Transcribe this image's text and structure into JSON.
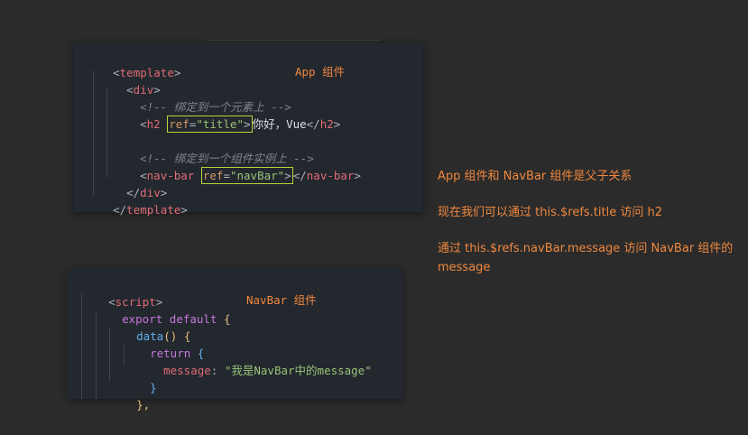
{
  "template_block": {
    "annotation": "App 组件",
    "line1": {
      "open": "<",
      "tag": "template",
      "close": ">"
    },
    "line2": {
      "open": "<",
      "tag": "div",
      "close": ">"
    },
    "line3": {
      "comment": "<!-- 绑定到一个元素上 -->"
    },
    "line4": {
      "open": "<",
      "tag": "h2",
      "space": " ",
      "attr": "ref",
      "eq": "=",
      "value": "\"title\"",
      "close": ">",
      "text": "你好，Vue",
      "end_open": "</",
      "end_tag": "h2",
      "end_close": ">"
    },
    "line5": {
      "comment": "<!-- 绑定到一个组件实例上 -->"
    },
    "line6": {
      "open": "<",
      "tag": "nav-bar",
      "space": " ",
      "attr": "ref",
      "eq": "=",
      "value": "\"navBar\"",
      "close": ">",
      "end_open": "</",
      "end_tag": "nav-bar",
      "end_close": ">"
    },
    "line7": {
      "open": "</",
      "tag": "div",
      "close": ">"
    },
    "line8": {
      "open": "</",
      "tag": "template",
      "close": ">"
    }
  },
  "script_block": {
    "annotation": "NavBar 组件",
    "line1": {
      "open": "<",
      "tag": "script",
      "close": ">"
    },
    "line2": {
      "kw1": "export",
      "kw2": "default",
      "brace": "{"
    },
    "line3": {
      "fn": "data",
      "paren": "()",
      "brace": "{"
    },
    "line4": {
      "kw": "return",
      "brace": "{"
    },
    "line5": {
      "prop": "message",
      "colon": ":",
      "value": "\"我是NavBar中的message\""
    },
    "line6": {
      "brace": "}"
    },
    "line7": {
      "brace": "},"
    }
  },
  "notes": {
    "relation": "App 组件和 NavBar 组件是父子关系",
    "access_h2": "现在我们可以通过 this.$refs.title 访问 h2",
    "access_navbar_line1": "通过 this.$refs.navBar.message 访问 NavBar 组件的",
    "access_navbar_line2": "message"
  },
  "colors": {
    "background": "#2b2b2b",
    "code_bg": "#23272e",
    "annotation": "#f0883e",
    "highlight_box": "#b7d33a",
    "tag": "#e06c75",
    "string": "#98c379",
    "attribute": "#d19a66",
    "keyword": "#c678dd",
    "function": "#61afef",
    "comment": "#7f848e"
  }
}
